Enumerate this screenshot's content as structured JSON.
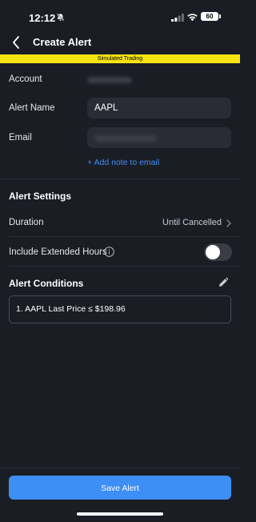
{
  "status_bar": {
    "time": "12:12",
    "battery": "60"
  },
  "header": {
    "title": "Create Alert"
  },
  "banner": {
    "text": "Simulated Trading"
  },
  "form": {
    "account_label": "Account",
    "alert_name_label": "Alert Name",
    "alert_name_value": "AAPL",
    "email_label": "Email",
    "add_note_link": "+ Add note to email"
  },
  "settings": {
    "title": "Alert Settings",
    "duration_label": "Duration",
    "duration_value": "Until Cancelled",
    "extended_hours_label": "Include Extended Hours",
    "extended_hours_on": false
  },
  "conditions": {
    "title": "Alert Conditions",
    "items": [
      "1. AAPL Last Price ≤ $198.96"
    ]
  },
  "footer": {
    "save_label": "Save Alert"
  },
  "colors": {
    "accent": "#3d8ef5",
    "banner": "#f6e312",
    "background": "#1b1d25"
  }
}
